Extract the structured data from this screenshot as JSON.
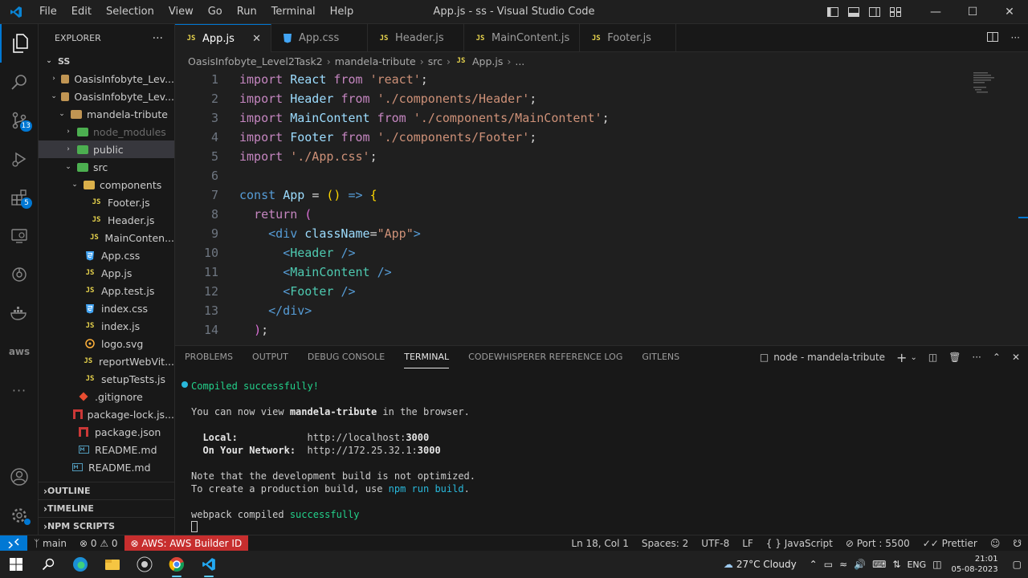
{
  "titlebar": {
    "menu": [
      "File",
      "Edit",
      "Selection",
      "View",
      "Go",
      "Run",
      "Terminal",
      "Help"
    ],
    "title": "App.js - ss - Visual Studio Code"
  },
  "activity": {
    "source_control_badge": "13",
    "extensions_badge": "5",
    "aws_label": "aws"
  },
  "sidebar": {
    "header": "EXPLORER",
    "root": "SS",
    "tree": [
      {
        "label": "OasisInfobyte_Lev...",
        "depth": 1,
        "chev": "›",
        "icon": "folder"
      },
      {
        "label": "OasisInfobyte_Lev...",
        "depth": 1,
        "chev": "⌄",
        "icon": "folder"
      },
      {
        "label": "mandela-tribute",
        "depth": 2,
        "chev": "⌄",
        "icon": "folder"
      },
      {
        "label": "node_modules",
        "depth": 3,
        "chev": "›",
        "icon": "folder-green",
        "muted": true
      },
      {
        "label": "public",
        "depth": 3,
        "chev": "›",
        "icon": "folder-green",
        "selected": true
      },
      {
        "label": "src",
        "depth": 3,
        "chev": "⌄",
        "icon": "folder-green"
      },
      {
        "label": "components",
        "depth": 4,
        "chev": "⌄",
        "icon": "folder-gold"
      },
      {
        "label": "Footer.js",
        "depth": 5,
        "icon": "js"
      },
      {
        "label": "Header.js",
        "depth": 5,
        "icon": "js"
      },
      {
        "label": "MainConten...",
        "depth": 5,
        "icon": "js"
      },
      {
        "label": "App.css",
        "depth": 4,
        "icon": "css"
      },
      {
        "label": "App.js",
        "depth": 4,
        "icon": "js"
      },
      {
        "label": "App.test.js",
        "depth": 4,
        "icon": "js"
      },
      {
        "label": "index.css",
        "depth": 4,
        "icon": "css"
      },
      {
        "label": "index.js",
        "depth": 4,
        "icon": "js"
      },
      {
        "label": "logo.svg",
        "depth": 4,
        "icon": "svg"
      },
      {
        "label": "reportWebVit...",
        "depth": 4,
        "icon": "js"
      },
      {
        "label": "setupTests.js",
        "depth": 4,
        "icon": "js"
      },
      {
        "label": ".gitignore",
        "depth": 3,
        "icon": "git"
      },
      {
        "label": "package-lock.js...",
        "depth": 3,
        "icon": "npm"
      },
      {
        "label": "package.json",
        "depth": 3,
        "icon": "npm"
      },
      {
        "label": "README.md",
        "depth": 3,
        "icon": "md"
      },
      {
        "label": "README.md",
        "depth": 2,
        "icon": "md"
      }
    ],
    "sections": [
      "OUTLINE",
      "TIMELINE",
      "NPM SCRIPTS"
    ]
  },
  "tabs": [
    {
      "label": "App.js",
      "icon": "js",
      "active": true
    },
    {
      "label": "App.css",
      "icon": "css"
    },
    {
      "label": "Header.js",
      "icon": "js"
    },
    {
      "label": "MainContent.js",
      "icon": "js"
    },
    {
      "label": "Footer.js",
      "icon": "js"
    }
  ],
  "breadcrumb": [
    "OasisInfobyte_Level2Task2",
    "mandela-tribute",
    "src",
    "App.js",
    "..."
  ],
  "code": [
    {
      "n": "1",
      "t": [
        [
          "kw",
          "import "
        ],
        [
          "var",
          "React "
        ],
        [
          "kw",
          "from "
        ],
        [
          "str",
          "'react'"
        ],
        [
          "",
          "; "
        ]
      ]
    },
    {
      "n": "2",
      "t": [
        [
          "kw",
          "import "
        ],
        [
          "var",
          "Header "
        ],
        [
          "kw",
          "from "
        ],
        [
          "str",
          "'./components/Header'"
        ],
        [
          "",
          ";"
        ]
      ]
    },
    {
      "n": "3",
      "t": [
        [
          "kw",
          "import "
        ],
        [
          "var",
          "MainContent "
        ],
        [
          "kw",
          "from "
        ],
        [
          "str",
          "'./components/MainContent'"
        ],
        [
          "",
          ";"
        ]
      ]
    },
    {
      "n": "4",
      "t": [
        [
          "kw",
          "import "
        ],
        [
          "var",
          "Footer "
        ],
        [
          "kw",
          "from "
        ],
        [
          "str",
          "'./components/Footer'"
        ],
        [
          "",
          ";"
        ]
      ]
    },
    {
      "n": "5",
      "t": [
        [
          "kw",
          "import "
        ],
        [
          "str",
          "'./App.css'"
        ],
        [
          "",
          ";"
        ]
      ]
    },
    {
      "n": "6",
      "t": []
    },
    {
      "n": "7",
      "t": [
        [
          "kb",
          "const "
        ],
        [
          "var",
          "App "
        ],
        [
          "",
          "= "
        ],
        [
          "br1",
          "() "
        ],
        [
          "kb",
          "=> "
        ],
        [
          "br1",
          "{"
        ]
      ]
    },
    {
      "n": "8",
      "t": [
        [
          "",
          "  "
        ],
        [
          "kw",
          "return "
        ],
        [
          "br2",
          "("
        ]
      ]
    },
    {
      "n": "9",
      "t": [
        [
          "",
          "    "
        ],
        [
          "tag",
          "<div "
        ],
        [
          "attr",
          "className"
        ],
        [
          "",
          "="
        ],
        [
          "str",
          "\"App\""
        ],
        [
          "tag",
          ">"
        ]
      ]
    },
    {
      "n": "10",
      "t": [
        [
          "",
          "      "
        ],
        [
          "tag",
          "<"
        ],
        [
          "cmp",
          "Header "
        ],
        [
          "tag",
          "/>"
        ]
      ]
    },
    {
      "n": "11",
      "t": [
        [
          "",
          "      "
        ],
        [
          "tag",
          "<"
        ],
        [
          "cmp",
          "MainContent "
        ],
        [
          "tag",
          "/>"
        ]
      ]
    },
    {
      "n": "12",
      "t": [
        [
          "",
          "      "
        ],
        [
          "tag",
          "<"
        ],
        [
          "cmp",
          "Footer "
        ],
        [
          "tag",
          "/>"
        ]
      ]
    },
    {
      "n": "13",
      "t": [
        [
          "",
          "    "
        ],
        [
          "tag",
          "</div>"
        ]
      ]
    },
    {
      "n": "14",
      "t": [
        [
          "",
          "  "
        ],
        [
          "br2",
          ")"
        ],
        [
          "",
          ";"
        ]
      ]
    }
  ],
  "panel": {
    "tabs": [
      "PROBLEMS",
      "OUTPUT",
      "DEBUG CONSOLE",
      "TERMINAL",
      "CODEWHISPERER REFERENCE LOG",
      "GITLENS"
    ],
    "active_tab": "TERMINAL",
    "terminal_name": "node - mandela-tribute",
    "lines": [
      {
        "parts": [
          [
            "tg",
            "Compiled successfully!"
          ]
        ]
      },
      {
        "parts": []
      },
      {
        "parts": [
          [
            "",
            "You can now view "
          ],
          [
            "tb",
            "mandela-tribute"
          ],
          [
            "",
            " in the browser."
          ]
        ]
      },
      {
        "parts": []
      },
      {
        "parts": [
          [
            "tb",
            "  Local:            "
          ],
          [
            "",
            "http://localhost:"
          ],
          [
            "tb",
            "3000"
          ]
        ]
      },
      {
        "parts": [
          [
            "tb",
            "  On Your Network:  "
          ],
          [
            "",
            "http://172.25.32.1:"
          ],
          [
            "tb",
            "3000"
          ]
        ]
      },
      {
        "parts": []
      },
      {
        "parts": [
          [
            "",
            "Note that the development build is not optimized."
          ]
        ]
      },
      {
        "parts": [
          [
            "",
            "To create a production build, use "
          ],
          [
            "tcy",
            "npm run build"
          ],
          [
            "",
            "."
          ]
        ]
      },
      {
        "parts": []
      },
      {
        "parts": [
          [
            "",
            "webpack compiled "
          ],
          [
            "tg",
            "successfully"
          ]
        ]
      }
    ]
  },
  "status": {
    "branch": "main",
    "problems": "⊗ 0 ⚠ 0",
    "aws": "AWS: AWS Builder ID",
    "position": "Ln 18, Col 1",
    "spaces": "Spaces: 2",
    "encoding": "UTF-8",
    "eol": "LF",
    "language": "JavaScript",
    "port": "Port : 5500",
    "prettier": "Prettier"
  },
  "taskbar": {
    "weather": "27°C  Cloudy",
    "lang": "ENG",
    "time": "21:01",
    "date": "05-08-2023"
  }
}
